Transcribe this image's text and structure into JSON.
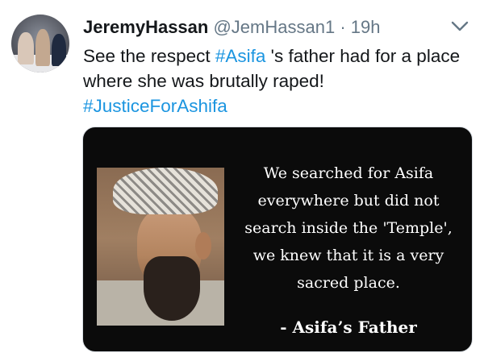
{
  "author": {
    "name": "JeremyHassan",
    "handle": "@JemHassan1",
    "separator": "·",
    "time": "19h"
  },
  "tweet": {
    "text_before": "See the respect ",
    "hashtag_1": "#Asifa",
    "text_after": " 's father had for a place where she was brutally raped!",
    "hashtag_2": "#JusticeForAshifa"
  },
  "media": {
    "quote_lines": [
      "We searched for Asifa",
      "everywhere but did not",
      "search inside the 'Temple',",
      "we knew that it is a very",
      "sacred place."
    ],
    "attribution": "- Asifa’s Father"
  },
  "icons": {
    "menu": "chevron-down-icon",
    "avatar": "profile-photo"
  },
  "colors": {
    "link": "#1b95e0",
    "secondary_text": "#657786",
    "primary_text": "#14171a"
  }
}
